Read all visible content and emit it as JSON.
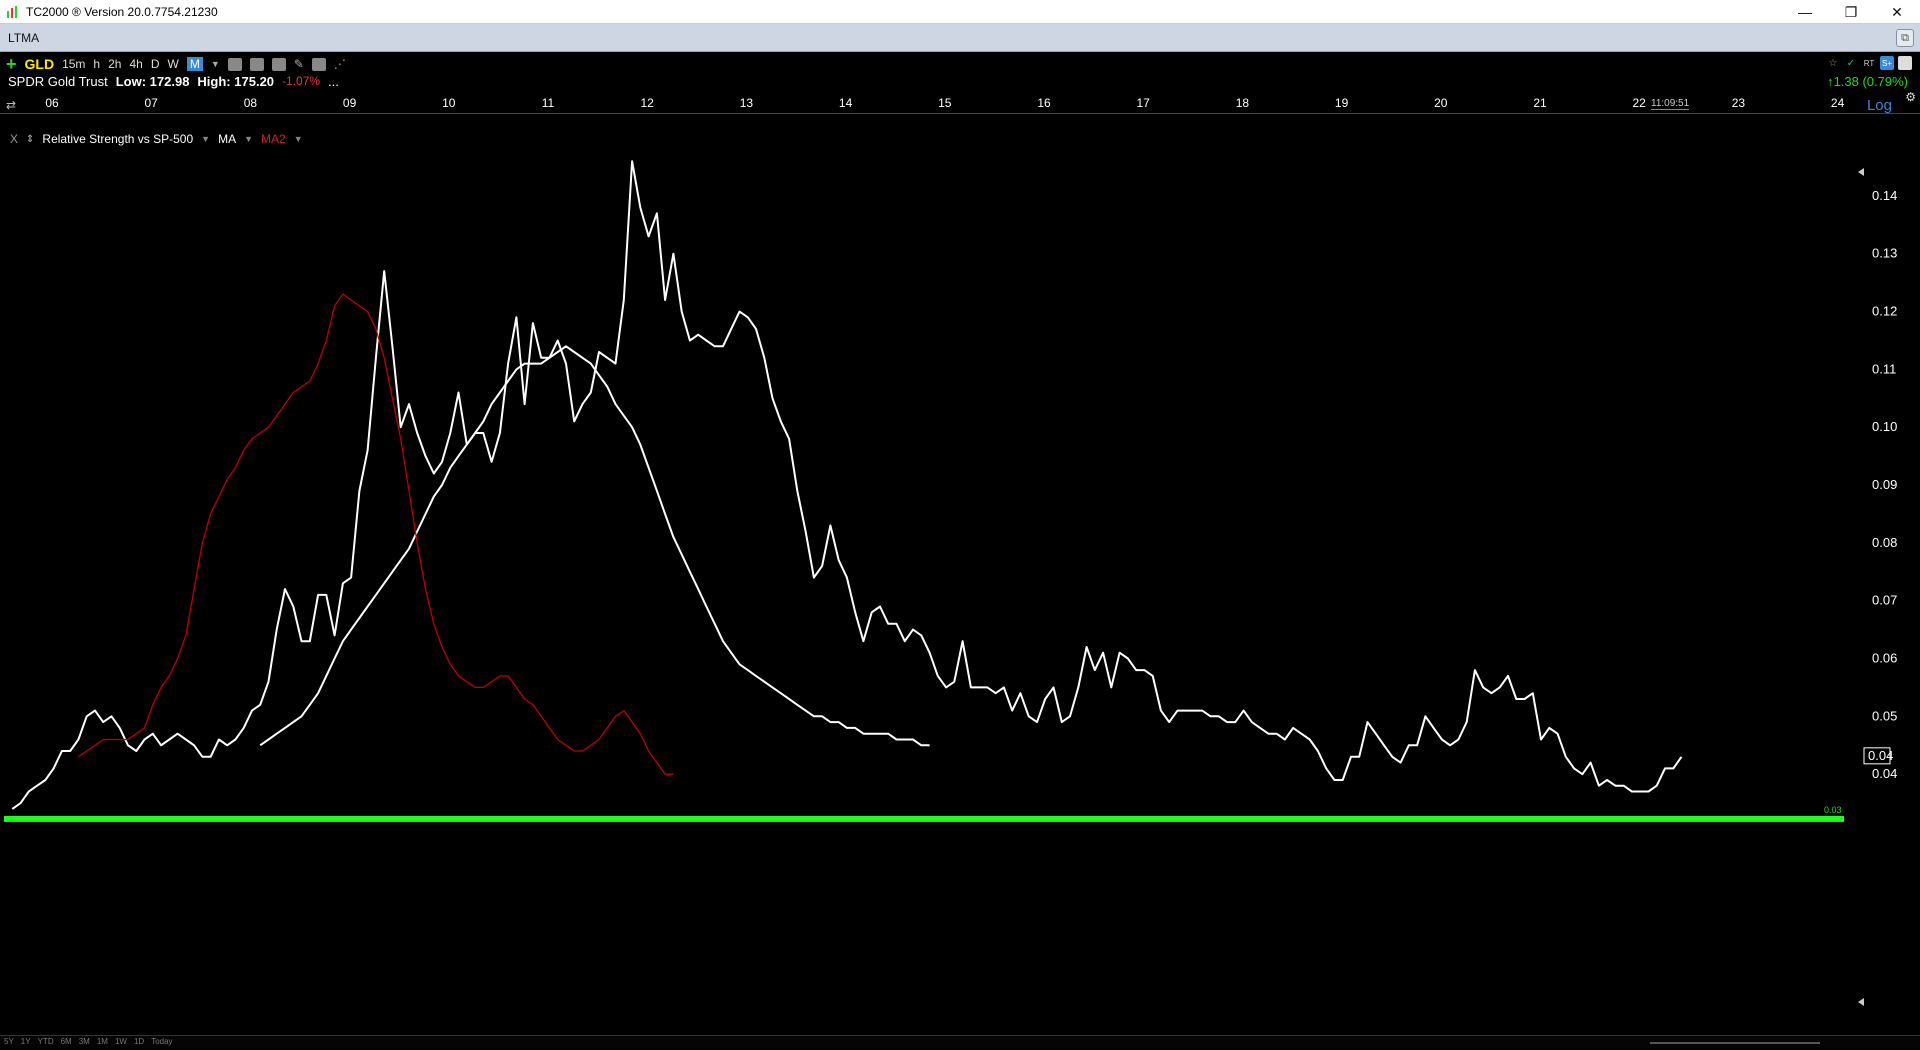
{
  "window": {
    "title": "TC2000 ® Version 20.0.7754.21230",
    "controls": [
      "—",
      "❐",
      "✕"
    ]
  },
  "tab": {
    "label": "LTMA"
  },
  "toolbar": {
    "symbol": "GLD",
    "timeframes": [
      "15m",
      "h",
      "2h",
      "4h",
      "D",
      "W",
      "M"
    ],
    "active_timeframe": "M"
  },
  "info": {
    "name": "SPDR Gold Trust",
    "low_label": "Low:",
    "low": "172.98",
    "high_label": "High:",
    "high": "175.20",
    "pct": "-1.07%",
    "ellipsis": "...",
    "change": "1.38 (0.79%)",
    "change_arrow": "↑"
  },
  "right_icons": [
    "☆",
    "✓",
    "RT",
    "S+"
  ],
  "xaxis": {
    "ticks": [
      "06",
      "07",
      "08",
      "09",
      "10",
      "11",
      "12",
      "13",
      "14",
      "15",
      "16",
      "17",
      "18",
      "19",
      "20",
      "21",
      "22",
      "23",
      "24"
    ],
    "time": "11:09:51",
    "log_label": "Log"
  },
  "indicator": {
    "close": "X",
    "name": "Relative Strength vs SP-500",
    "ma": "MA",
    "ma2": "MA2"
  },
  "periods": [
    "5Y",
    "1Y",
    "YTD",
    "6M",
    "3M",
    "1M",
    "1W",
    "1D",
    "Today"
  ],
  "yaxis": {
    "ticks": [
      "0.14",
      "0.13",
      "0.12",
      "0.11",
      "0.10",
      "0.09",
      "0.08",
      "0.07",
      "0.06",
      "0.05",
      "0.04"
    ],
    "current_value": "0.04",
    "support_label": "0.03"
  },
  "chart_data": {
    "type": "line",
    "ylim": [
      0.03,
      0.145
    ],
    "x_start_year": 2005.6,
    "x_step": 0.0833,
    "support_level": 0.034,
    "series": [
      {
        "key": "rs",
        "color": "#ffffff",
        "values": [
          0.034,
          0.035,
          0.037,
          0.038,
          0.039,
          0.041,
          0.044,
          0.044,
          0.046,
          0.05,
          0.051,
          0.049,
          0.05,
          0.048,
          0.045,
          0.044,
          0.046,
          0.047,
          0.045,
          0.046,
          0.047,
          0.046,
          0.045,
          0.043,
          0.043,
          0.046,
          0.045,
          0.046,
          0.048,
          0.051,
          0.052,
          0.056,
          0.065,
          0.072,
          0.069,
          0.063,
          0.063,
          0.071,
          0.071,
          0.064,
          0.073,
          0.074,
          0.089,
          0.096,
          0.112,
          0.127,
          0.114,
          0.1,
          0.104,
          0.099,
          0.095,
          0.092,
          0.094,
          0.099,
          0.106,
          0.097,
          0.099,
          0.099,
          0.094,
          0.099,
          0.111,
          0.119,
          0.104,
          0.118,
          0.112,
          0.112,
          0.115,
          0.111,
          0.101,
          0.104,
          0.106,
          0.113,
          0.112,
          0.111,
          0.122,
          0.146,
          0.138,
          0.133,
          0.137,
          0.122,
          0.13,
          0.12,
          0.115,
          0.116,
          0.115,
          0.114,
          0.114,
          0.117,
          0.12,
          0.119,
          0.117,
          0.112,
          0.105,
          0.101,
          0.098,
          0.089,
          0.082,
          0.074,
          0.076,
          0.083,
          0.077,
          0.074,
          0.068,
          0.063,
          0.068,
          0.069,
          0.066,
          0.066,
          0.063,
          0.065,
          0.064,
          0.061,
          0.057,
          0.055,
          0.056,
          0.063,
          0.055,
          0.055,
          0.055,
          0.054,
          0.055,
          0.051,
          0.054,
          0.05,
          0.049,
          0.053,
          0.055,
          0.049,
          0.05,
          0.055,
          0.062,
          0.058,
          0.061,
          0.055,
          0.061,
          0.06,
          0.058,
          0.058,
          0.057,
          0.051,
          0.049,
          0.051,
          0.051,
          0.051,
          0.051,
          0.05,
          0.05,
          0.049,
          0.049,
          0.051,
          0.049,
          0.048,
          0.047,
          0.047,
          0.046,
          0.048,
          0.047,
          0.046,
          0.044,
          0.041,
          0.039,
          0.039,
          0.043,
          0.043,
          0.049,
          0.047,
          0.045,
          0.043,
          0.042,
          0.045,
          0.045,
          0.05,
          0.048,
          0.046,
          0.045,
          0.046,
          0.049,
          0.058,
          0.055,
          0.054,
          0.055,
          0.057,
          0.053,
          0.053,
          0.054,
          0.046,
          0.048,
          0.047,
          0.043,
          0.041,
          0.04,
          0.042,
          0.038,
          0.039,
          0.038,
          0.038,
          0.037,
          0.037,
          0.037,
          0.038,
          0.041,
          0.041,
          0.043
        ]
      },
      {
        "key": "ma",
        "color": "#ffffff",
        "start_index": 30,
        "values": [
          0.045,
          0.046,
          0.047,
          0.048,
          0.049,
          0.05,
          0.052,
          0.054,
          0.057,
          0.06,
          0.063,
          0.065,
          0.067,
          0.069,
          0.071,
          0.073,
          0.075,
          0.077,
          0.079,
          0.082,
          0.085,
          0.088,
          0.09,
          0.093,
          0.095,
          0.097,
          0.099,
          0.101,
          0.104,
          0.106,
          0.108,
          0.11,
          0.111,
          0.111,
          0.111,
          0.112,
          0.113,
          0.114,
          0.113,
          0.112,
          0.111,
          0.109,
          0.107,
          0.104,
          0.102,
          0.1,
          0.097,
          0.093,
          0.089,
          0.085,
          0.081,
          0.078,
          0.075,
          0.072,
          0.069,
          0.066,
          0.063,
          0.061,
          0.059,
          0.058,
          0.057,
          0.056,
          0.055,
          0.054,
          0.053,
          0.052,
          0.051,
          0.05,
          0.05,
          0.049,
          0.049,
          0.048,
          0.048,
          0.047,
          0.047,
          0.047,
          0.047,
          0.046,
          0.046,
          0.046,
          0.045,
          0.045
        ]
      },
      {
        "key": "ma2",
        "color": "#c00000",
        "start_index": 8,
        "values": [
          0.043,
          0.044,
          0.045,
          0.046,
          0.046,
          0.046,
          0.046,
          0.047,
          0.048,
          0.052,
          0.055,
          0.057,
          0.06,
          0.064,
          0.072,
          0.08,
          0.085,
          0.088,
          0.091,
          0.093,
          0.096,
          0.098,
          0.099,
          0.1,
          0.102,
          0.104,
          0.106,
          0.107,
          0.108,
          0.111,
          0.115,
          0.121,
          0.123,
          0.122,
          0.121,
          0.12,
          0.117,
          0.112,
          0.105,
          0.098,
          0.089,
          0.08,
          0.072,
          0.066,
          0.062,
          0.059,
          0.057,
          0.056,
          0.055,
          0.055,
          0.056,
          0.057,
          0.057,
          0.055,
          0.053,
          0.052,
          0.05,
          0.048,
          0.046,
          0.045,
          0.044,
          0.044,
          0.045,
          0.046,
          0.048,
          0.05,
          0.051,
          0.049,
          0.047,
          0.044,
          0.042,
          0.04,
          0.04
        ]
      }
    ]
  }
}
